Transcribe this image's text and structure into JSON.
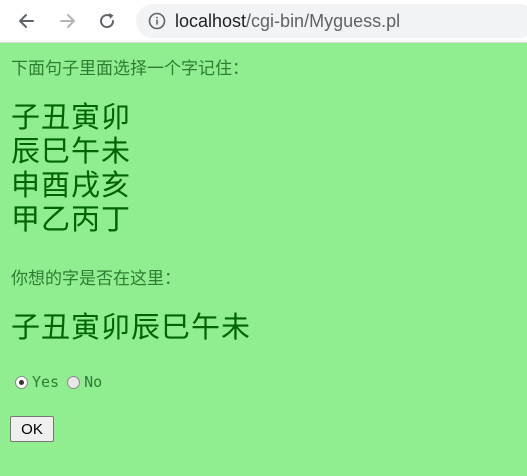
{
  "browser": {
    "url_host": "localhost",
    "url_path": "/cgi-bin/Myguess.pl"
  },
  "page": {
    "prompt_select": "下面句子里面选择一个字记住：",
    "char_rows": [
      "子丑寅卯",
      "辰巳午未",
      "申酉戌亥",
      "甲乙丙丁"
    ],
    "prompt_question": "你想的字是否在这里：",
    "question_chars": "子丑寅卯辰巳午未",
    "options": [
      {
        "label": "Yes",
        "checked": true
      },
      {
        "label": "No",
        "checked": false
      }
    ],
    "submit_label": "OK"
  },
  "colors": {
    "background": "#90ee90",
    "text": "#006400"
  }
}
